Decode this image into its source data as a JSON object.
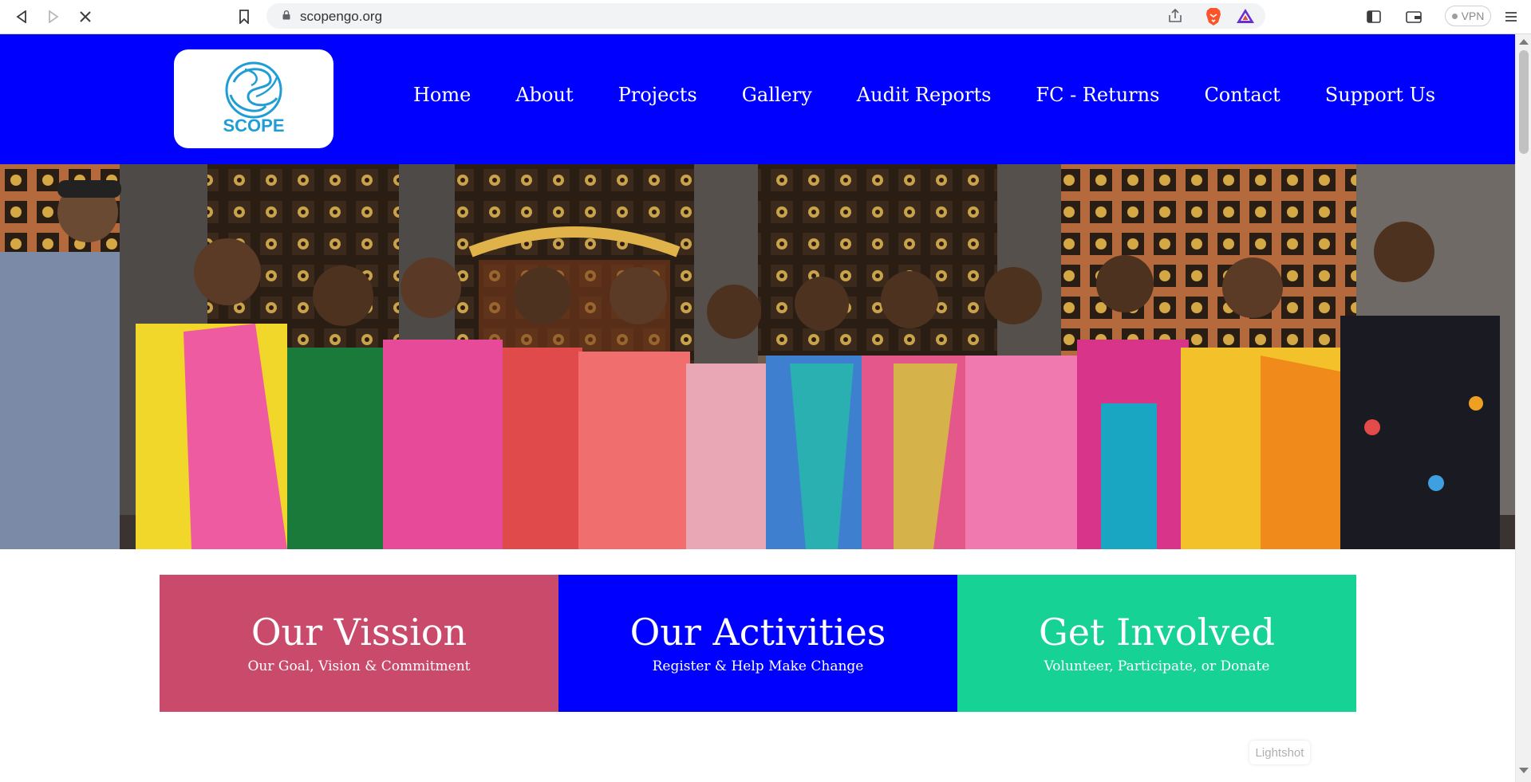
{
  "browser": {
    "url": "scopengo.org",
    "vpn_label": "VPN",
    "icons": [
      "back-icon",
      "forward-icon",
      "stop-icon",
      "bookmark-icon",
      "lock-icon",
      "share-icon",
      "brave-lion-icon",
      "rewards-triangle-icon",
      "sidebar-icon",
      "wallet-icon",
      "menu-icon"
    ]
  },
  "logo": {
    "text": "SCOPE"
  },
  "nav": {
    "items": [
      "Home",
      "About",
      "Projects",
      "Gallery",
      "Audit Reports",
      "FC - Returns",
      "Contact",
      "Support Us"
    ]
  },
  "hero": {
    "description": "group photo"
  },
  "features": [
    {
      "title": "Our Vission",
      "subtitle": "Our Goal, Vision & Commitment",
      "color": "#c94a6b"
    },
    {
      "title": "Our Activities",
      "subtitle": "Register & Help Make Change",
      "color": "#0000ff"
    },
    {
      "title": "Get Involved",
      "subtitle": "Volunteer, Participate, or Donate",
      "color": "#16d294"
    }
  ],
  "lightshot_label": "Lightshot",
  "colors": {
    "header": "#0000ff",
    "accent_pink": "#c94a6b",
    "accent_green": "#16d294"
  }
}
